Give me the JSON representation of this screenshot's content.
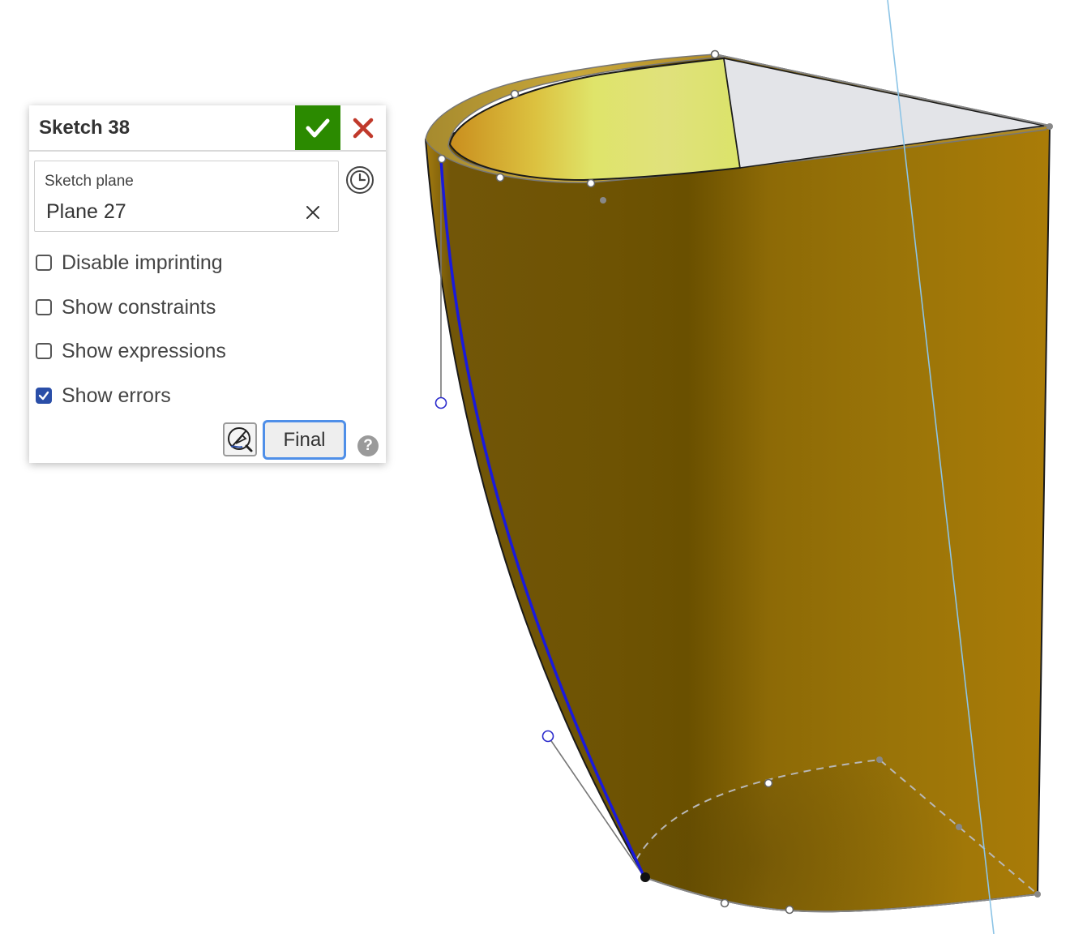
{
  "sketch_panel": {
    "title": "Sketch 38",
    "accept_icon": "checkmark-icon",
    "cancel_icon": "close-icon",
    "sketch_plane": {
      "label": "Sketch plane",
      "value": "Plane 27",
      "clear_icon": "clear-x-icon"
    },
    "history_icon": "clock-history-icon",
    "options": [
      {
        "label": "Disable imprinting",
        "checked": false
      },
      {
        "label": "Show constraints",
        "checked": false
      },
      {
        "label": "Show expressions",
        "checked": false
      },
      {
        "label": "Show errors",
        "checked": true
      }
    ],
    "inspect_icon": "sketch-inspect-icon",
    "final_label": "Final",
    "help_label": "?"
  },
  "viewport": {
    "model": "swept-solid",
    "colors": {
      "solid_dark": "#6b5100",
      "solid_light": "#a8790a",
      "inner_face": "#dde46a",
      "planar_face": "#e3e4e8",
      "sketch_curve": "#1a1adb",
      "axis_line": "#8cc4e6",
      "edge": "#1a1a1a",
      "accept_green": "#2b8a00",
      "cancel_red": "#c0392b",
      "checkbox_blue": "#2a4ea8",
      "focus_blue": "#4f8fe8"
    }
  }
}
